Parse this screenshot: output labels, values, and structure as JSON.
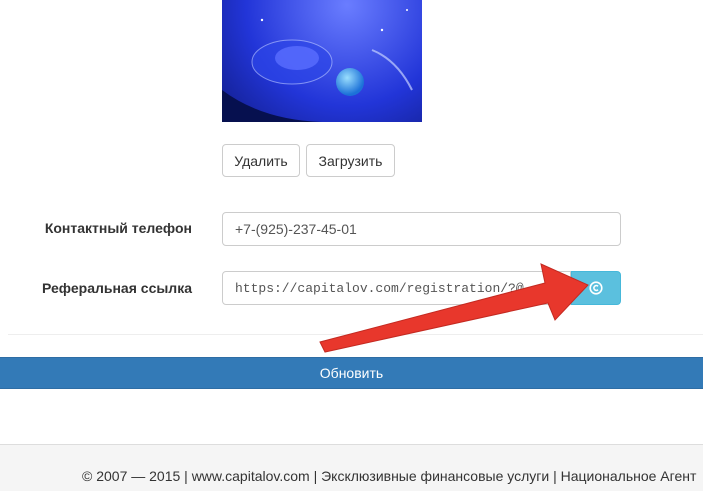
{
  "profile": {
    "avatar_icon": "avatar-photo"
  },
  "avatar_actions": {
    "delete_label": "Удалить",
    "upload_label": "Загрузить"
  },
  "form": {
    "phone_label": "Контактный телефон",
    "phone_value": "+7-(925)-237-45-01",
    "referral_label": "Реферальная ссылка",
    "referral_value": "https://capitalov.com/registration/?@",
    "copy_icon": "copyright-icon",
    "update_label": "Обновить"
  },
  "footer": {
    "text": "© 2007 — 2015 | www.capitalov.com | Эксклюзивные финансовые услуги | Национальное Агент"
  },
  "colors": {
    "primary": "#337ab7",
    "info": "#5bc0de",
    "annotation_arrow": "#e8372c"
  }
}
